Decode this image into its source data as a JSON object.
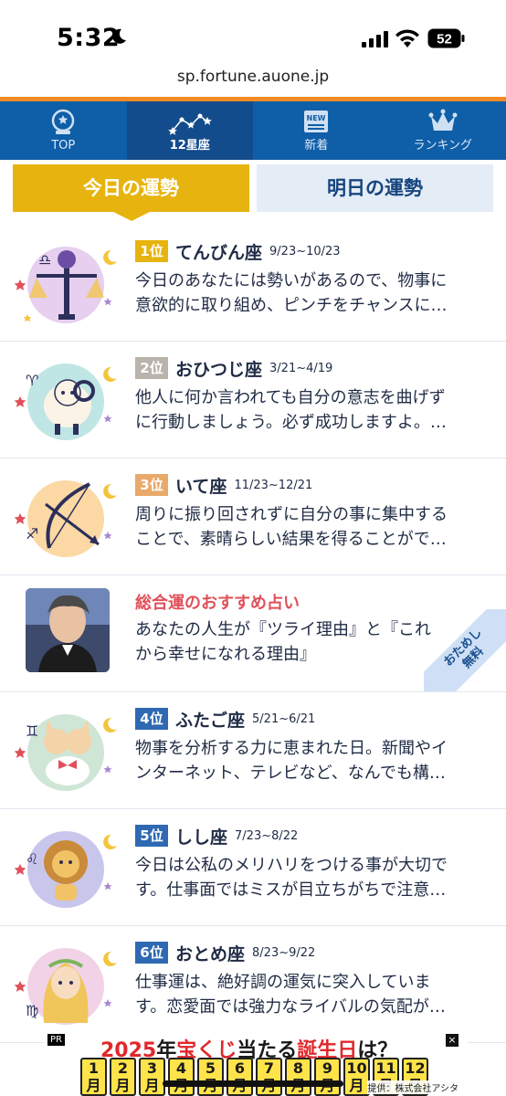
{
  "status_bar": {
    "time": "5:32",
    "battery": "52",
    "url": "sp.fortune.auone.jp"
  },
  "nav": {
    "items": [
      {
        "label": "TOP",
        "icon": "crystal-ball-icon"
      },
      {
        "label": "12星座",
        "icon": "constellation-icon",
        "active": true
      },
      {
        "label": "新着",
        "icon": "new-badge-icon",
        "badge": "NEW"
      },
      {
        "label": "ランキング",
        "icon": "crown-icon"
      }
    ]
  },
  "tabs": {
    "today": "今日の運勢",
    "tomorrow": "明日の運勢"
  },
  "rows": [
    {
      "rank": "1位",
      "sign": "てんびん座",
      "dates": "9/23~10/23",
      "line1": "今日のあなたには勢いがあるので、物事に",
      "line2": "意欲的に取り組め、ピンチをチャンスに…",
      "rank_color": "#e7b40f",
      "bg": "#e7cfef",
      "icon": "libra-icon"
    },
    {
      "rank": "2位",
      "sign": "おひつじ座",
      "dates": "3/21~4/19",
      "line1": "他人に何か言われても自分の意志を曲げず",
      "line2": "に行動しましょう。必ず成功しますよ。…",
      "rank_color": "#b9b3ab",
      "bg": "#bfe6e4",
      "icon": "aries-icon"
    },
    {
      "rank": "3位",
      "sign": "いて座",
      "dates": "11/23~12/21",
      "line1": "周りに振り回されずに自分の事に集中する",
      "line2": "ことで、素晴らしい結果を得ることがで…",
      "rank_color": "#e9a96a",
      "bg": "#fbd8a4",
      "icon": "sagittarius-icon"
    },
    {
      "rank": "4位",
      "sign": "ふたご座",
      "dates": "5/21~6/21",
      "line1": "物事を分析する力に恵まれた日。新聞やイ",
      "line2": "ンターネット、テレビなど、なんでも構…",
      "rank_color": "#2f69b3",
      "bg": "#cfe6d6",
      "icon": "gemini-icon"
    },
    {
      "rank": "5位",
      "sign": "しし座",
      "dates": "7/23~8/22",
      "line1": "今日は公私のメリハリをつける事が大切で",
      "line2": "す。仕事面ではミスが目立ちがちで注意…",
      "rank_color": "#2f69b3",
      "bg": "#c9c6ec",
      "icon": "leo-icon"
    },
    {
      "rank": "6位",
      "sign": "おとめ座",
      "dates": "8/23~9/22",
      "line1": "仕事運は、絶好調の運気に突入していま",
      "line2": "す。恋愛面では強力なライバルの気配が…",
      "rank_color": "#2f69b3",
      "bg": "#f1d2e6",
      "icon": "virgo-icon"
    }
  ],
  "promo": {
    "title": "総合運のおすすめ占い",
    "line1": "あなたの人生が『ツライ理由』と『これ",
    "line2": "から幸せになれる理由』",
    "ribbon": "おためし\n無料"
  },
  "ad": {
    "pr": "PR",
    "close": "×",
    "headline_a": "2025",
    "headline_b": "年",
    "headline_c": "宝くじ",
    "headline_d": "当たる",
    "headline_e": "誕生日",
    "headline_f": "は？",
    "months": [
      "1月",
      "2月",
      "3月",
      "4月",
      "5月",
      "6月",
      "7月",
      "8月",
      "9月",
      "10月",
      "11月",
      "12月"
    ],
    "credit": "提供：株式会社アシタ"
  }
}
